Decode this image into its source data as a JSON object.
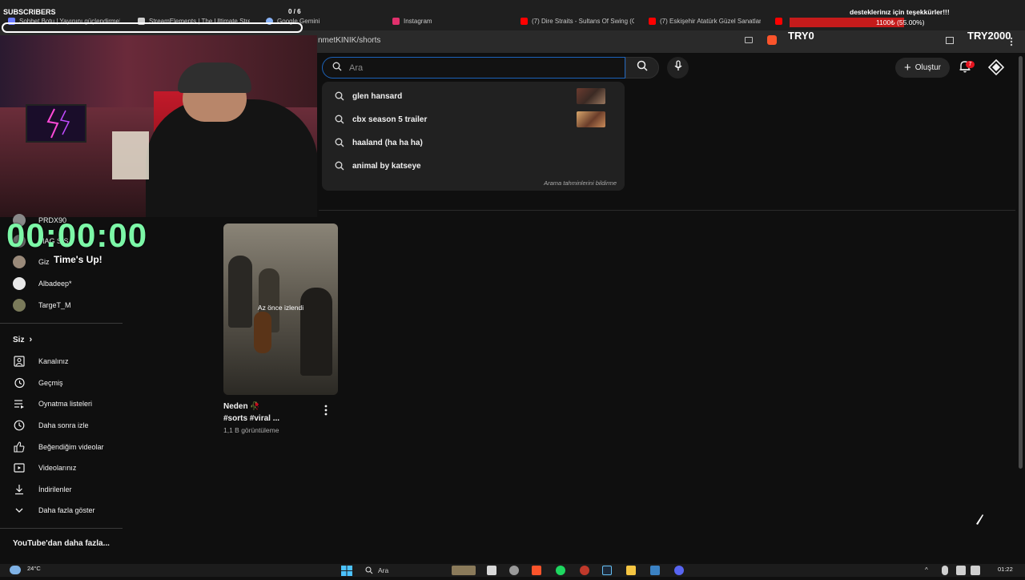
{
  "browser": {
    "tabs": [
      {
        "label": "Sohbet Botu | Yayınını güçlendirme!",
        "color": "#6c7cff"
      },
      {
        "label": "StreamElements | The Ultimate Strea",
        "color": "#cfcfcf"
      },
      {
        "label": "Google Gemini",
        "color": "#8ab4f8"
      },
      {
        "label": "Instagram",
        "color": "#e1306c"
      },
      {
        "label": "(7) Dire Straits - Sultans Of Swing (C",
        "color": "#ff0000"
      },
      {
        "label": "(7) Eskişehir Atatürk Güzel Sanatlar",
        "color": "#ff0000"
      }
    ],
    "url_fragment": "nmetKINIK/shorts"
  },
  "header": {
    "search_placeholder": "Ara",
    "create_label": "Oluştur",
    "notification_count": "7",
    "accent_color": "#1c62b9"
  },
  "suggestions": {
    "items": [
      {
        "text": "glen hansard",
        "has_thumb": true
      },
      {
        "text": "cbx season 5 trailer",
        "has_thumb": true
      },
      {
        "text": "haaland (ha ha ha)",
        "has_thumb": false
      },
      {
        "text": "animal by katseye",
        "has_thumb": false
      }
    ],
    "report_label": "Arama tahminlerini bildirme"
  },
  "sidebar": {
    "subscriptions": [
      {
        "label": "PRDX90"
      },
      {
        "label": "MAG S S"
      },
      {
        "label": "Giz"
      },
      {
        "label": "Albadeep*"
      },
      {
        "label": "TargeT_M"
      }
    ],
    "you_section": {
      "title": "Siz",
      "items": [
        {
          "label": "Kanalınız",
          "icon": "channel-icon"
        },
        {
          "label": "Geçmiş",
          "icon": "history-icon"
        },
        {
          "label": "Oynatma listeleri",
          "icon": "playlist-icon"
        },
        {
          "label": "Daha sonra izle",
          "icon": "clock-icon"
        },
        {
          "label": "Beğendiğim videolar",
          "icon": "thumbs-up-icon"
        },
        {
          "label": "Videolarınız",
          "icon": "video-icon"
        },
        {
          "label": "İndirilenler",
          "icon": "download-icon"
        },
        {
          "label": "Daha fazla göster",
          "icon": "chevron-down-icon"
        }
      ]
    },
    "more_title": "YouTube'dan daha fazla..."
  },
  "video": {
    "overlay_text": "Az önce izlendi",
    "title_line1": "Neden 🥀",
    "title_line2": "#sorts #viral ...",
    "views": "1,1 B görüntüleme"
  },
  "stream_overlay": {
    "subs_label": "SUBSCRIBERS",
    "subs_count": "0 / 6",
    "donate_label": "desteklerinız için teşekkürler!!!",
    "donate_progress": "1100₺ (55.00%)",
    "donate_fraction": 0.55,
    "try_left": "TRY0",
    "try_right": "TRY2000",
    "timer": "00:00:00",
    "times_up": "Time's Up!"
  },
  "taskbar": {
    "temperature": "24°C",
    "search_label": "Ara",
    "time": "01:22"
  }
}
